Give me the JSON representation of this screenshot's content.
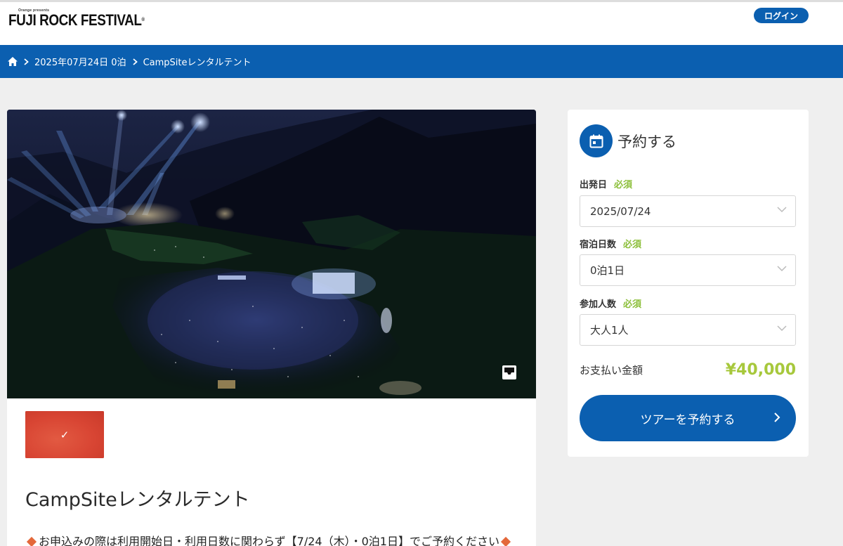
{
  "header": {
    "logo_sup": "Orange presents",
    "logo_text": "FUJI ROCK FESTIVAL",
    "logo_mark": "®",
    "login_label": "ログイン"
  },
  "breadcrumb": {
    "home_icon": "home-icon",
    "items": [
      "2025年07月24日 0泊",
      "CampSiteレンタルテント"
    ]
  },
  "product": {
    "hero_alt": "Fuji Rock festival night view with stage lights and crowd",
    "gallery_icon": "gallery-icon",
    "thumb_check": "✓",
    "title": "CampSiteレンタルテント",
    "notice": "お申込みの際は利用開始日・利用日数に関わらず【7/24（木）・0泊1日】でご予約ください"
  },
  "booking": {
    "title": "予約する",
    "fields": [
      {
        "label": "出発日",
        "required": "必須",
        "value": "2025/07/24"
      },
      {
        "label": "宿泊日数",
        "required": "必須",
        "value": "0泊1日"
      },
      {
        "label": "参加人数",
        "required": "必須",
        "value": "大人1人"
      }
    ],
    "price_label": "お支払い金額",
    "price_value": "¥40,000",
    "button_label": "ツアーを予約する"
  },
  "colors": {
    "brand_blue": "#0b5fb0",
    "price_green": "#a7c83c",
    "required_green": "#8cbf3a",
    "thumb_red": "#e14b3a"
  }
}
